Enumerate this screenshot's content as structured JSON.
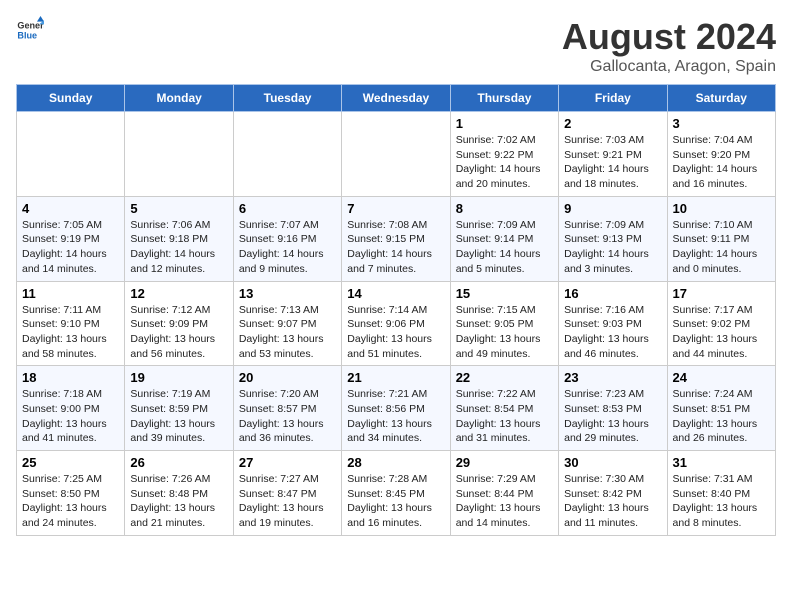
{
  "header": {
    "logo_general": "General",
    "logo_blue": "Blue",
    "title": "August 2024",
    "subtitle": "Gallocanta, Aragon, Spain"
  },
  "weekdays": [
    "Sunday",
    "Monday",
    "Tuesday",
    "Wednesday",
    "Thursday",
    "Friday",
    "Saturday"
  ],
  "weeks": [
    [
      {
        "day": "",
        "info": ""
      },
      {
        "day": "",
        "info": ""
      },
      {
        "day": "",
        "info": ""
      },
      {
        "day": "",
        "info": ""
      },
      {
        "day": "1",
        "info": "Sunrise: 7:02 AM\nSunset: 9:22 PM\nDaylight: 14 hours and 20 minutes."
      },
      {
        "day": "2",
        "info": "Sunrise: 7:03 AM\nSunset: 9:21 PM\nDaylight: 14 hours and 18 minutes."
      },
      {
        "day": "3",
        "info": "Sunrise: 7:04 AM\nSunset: 9:20 PM\nDaylight: 14 hours and 16 minutes."
      }
    ],
    [
      {
        "day": "4",
        "info": "Sunrise: 7:05 AM\nSunset: 9:19 PM\nDaylight: 14 hours and 14 minutes."
      },
      {
        "day": "5",
        "info": "Sunrise: 7:06 AM\nSunset: 9:18 PM\nDaylight: 14 hours and 12 minutes."
      },
      {
        "day": "6",
        "info": "Sunrise: 7:07 AM\nSunset: 9:16 PM\nDaylight: 14 hours and 9 minutes."
      },
      {
        "day": "7",
        "info": "Sunrise: 7:08 AM\nSunset: 9:15 PM\nDaylight: 14 hours and 7 minutes."
      },
      {
        "day": "8",
        "info": "Sunrise: 7:09 AM\nSunset: 9:14 PM\nDaylight: 14 hours and 5 minutes."
      },
      {
        "day": "9",
        "info": "Sunrise: 7:09 AM\nSunset: 9:13 PM\nDaylight: 14 hours and 3 minutes."
      },
      {
        "day": "10",
        "info": "Sunrise: 7:10 AM\nSunset: 9:11 PM\nDaylight: 14 hours and 0 minutes."
      }
    ],
    [
      {
        "day": "11",
        "info": "Sunrise: 7:11 AM\nSunset: 9:10 PM\nDaylight: 13 hours and 58 minutes."
      },
      {
        "day": "12",
        "info": "Sunrise: 7:12 AM\nSunset: 9:09 PM\nDaylight: 13 hours and 56 minutes."
      },
      {
        "day": "13",
        "info": "Sunrise: 7:13 AM\nSunset: 9:07 PM\nDaylight: 13 hours and 53 minutes."
      },
      {
        "day": "14",
        "info": "Sunrise: 7:14 AM\nSunset: 9:06 PM\nDaylight: 13 hours and 51 minutes."
      },
      {
        "day": "15",
        "info": "Sunrise: 7:15 AM\nSunset: 9:05 PM\nDaylight: 13 hours and 49 minutes."
      },
      {
        "day": "16",
        "info": "Sunrise: 7:16 AM\nSunset: 9:03 PM\nDaylight: 13 hours and 46 minutes."
      },
      {
        "day": "17",
        "info": "Sunrise: 7:17 AM\nSunset: 9:02 PM\nDaylight: 13 hours and 44 minutes."
      }
    ],
    [
      {
        "day": "18",
        "info": "Sunrise: 7:18 AM\nSunset: 9:00 PM\nDaylight: 13 hours and 41 minutes."
      },
      {
        "day": "19",
        "info": "Sunrise: 7:19 AM\nSunset: 8:59 PM\nDaylight: 13 hours and 39 minutes."
      },
      {
        "day": "20",
        "info": "Sunrise: 7:20 AM\nSunset: 8:57 PM\nDaylight: 13 hours and 36 minutes."
      },
      {
        "day": "21",
        "info": "Sunrise: 7:21 AM\nSunset: 8:56 PM\nDaylight: 13 hours and 34 minutes."
      },
      {
        "day": "22",
        "info": "Sunrise: 7:22 AM\nSunset: 8:54 PM\nDaylight: 13 hours and 31 minutes."
      },
      {
        "day": "23",
        "info": "Sunrise: 7:23 AM\nSunset: 8:53 PM\nDaylight: 13 hours and 29 minutes."
      },
      {
        "day": "24",
        "info": "Sunrise: 7:24 AM\nSunset: 8:51 PM\nDaylight: 13 hours and 26 minutes."
      }
    ],
    [
      {
        "day": "25",
        "info": "Sunrise: 7:25 AM\nSunset: 8:50 PM\nDaylight: 13 hours and 24 minutes."
      },
      {
        "day": "26",
        "info": "Sunrise: 7:26 AM\nSunset: 8:48 PM\nDaylight: 13 hours and 21 minutes."
      },
      {
        "day": "27",
        "info": "Sunrise: 7:27 AM\nSunset: 8:47 PM\nDaylight: 13 hours and 19 minutes."
      },
      {
        "day": "28",
        "info": "Sunrise: 7:28 AM\nSunset: 8:45 PM\nDaylight: 13 hours and 16 minutes."
      },
      {
        "day": "29",
        "info": "Sunrise: 7:29 AM\nSunset: 8:44 PM\nDaylight: 13 hours and 14 minutes."
      },
      {
        "day": "30",
        "info": "Sunrise: 7:30 AM\nSunset: 8:42 PM\nDaylight: 13 hours and 11 minutes."
      },
      {
        "day": "31",
        "info": "Sunrise: 7:31 AM\nSunset: 8:40 PM\nDaylight: 13 hours and 8 minutes."
      }
    ]
  ]
}
